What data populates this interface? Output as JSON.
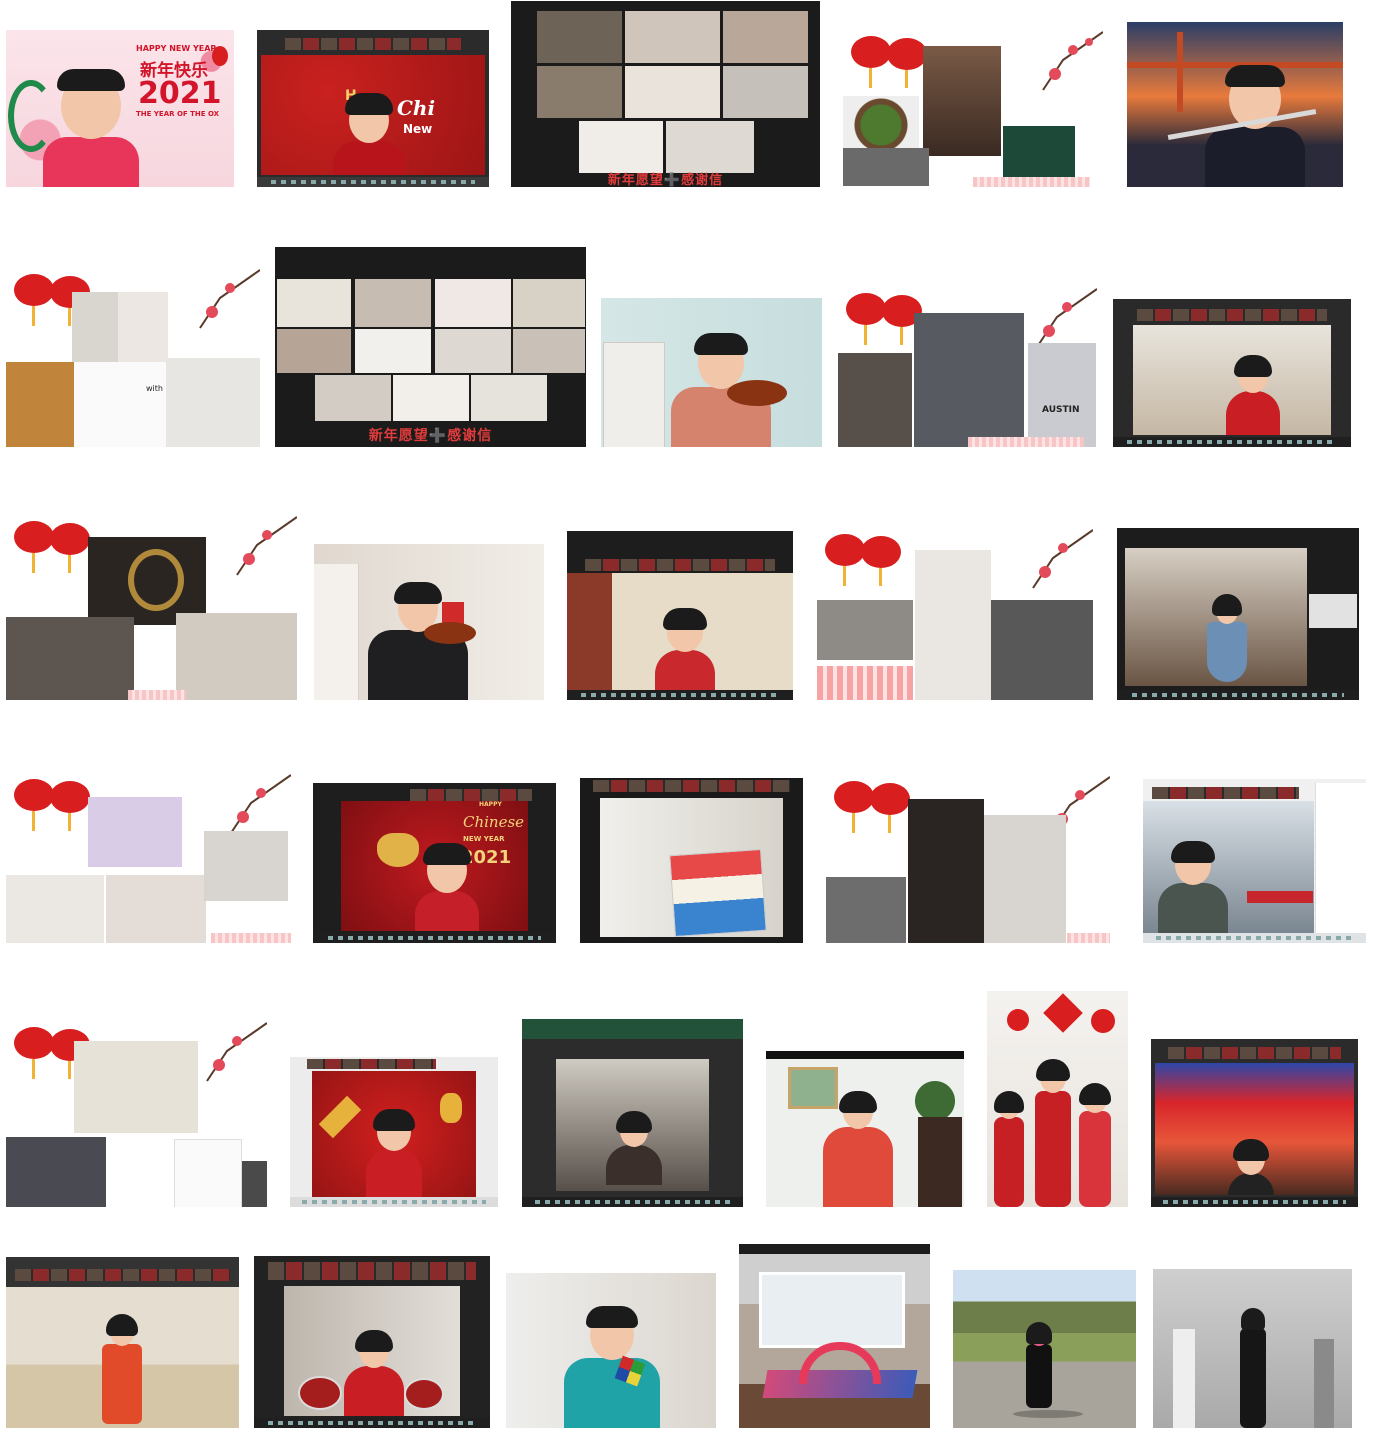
{
  "gallery": {
    "banner_card": {
      "line1": "HAPPY NEW YEAR",
      "line2": "新年快乐",
      "year": "2021",
      "line4": "THE YEAR OF THE OX"
    },
    "thank_you_caption": "新年愿望➕感谢信",
    "chinese_new_year_card": {
      "script": "Chinese",
      "happy": "HAPPY",
      "new_year": "NEW YEAR",
      "year": "2021"
    },
    "zoom_card_partial": {
      "h": "H",
      "chi": "Chi",
      "new": "New"
    },
    "with_label": "with",
    "austin_shirt": "AUSTIN"
  },
  "colors": {
    "festive_red": "#d81e1e",
    "zoom_dark": "#1f1f1f",
    "caption_red": "#e23b3b",
    "lantern_gold": "#f2b234"
  }
}
